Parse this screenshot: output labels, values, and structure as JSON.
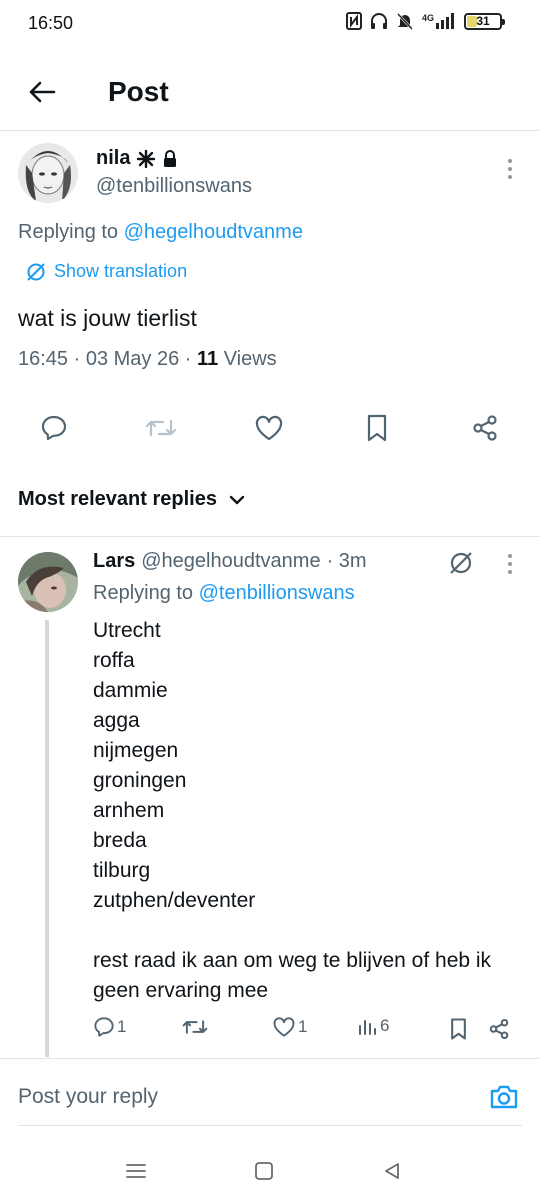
{
  "status_bar": {
    "time": "16:50",
    "network": "4G",
    "battery": "31",
    "battery_level": 0.31,
    "icons": [
      "nfc-icon",
      "headphones-icon",
      "bell-muted-icon",
      "signal-icon",
      "battery-icon"
    ]
  },
  "header": {
    "title": "Post",
    "back_icon": "arrow-left-icon"
  },
  "post": {
    "author_name": "nila",
    "author_handle": "@tenbillionswans",
    "badges": [
      "asterisk-icon",
      "lock-icon"
    ],
    "replying_prefix": "Replying to",
    "replying_to": "@hegelhoudtvanme",
    "show_translation": "Show translation",
    "text": "wat is jouw tierlist",
    "timestamp": "16:45 · 03 May 26 · ",
    "views_count": "11",
    "views_label": " Views",
    "actions": [
      "reply-icon",
      "repost-icon",
      "like-icon",
      "bookmark-icon",
      "share-icon"
    ]
  },
  "replies_sort": {
    "label": "Most relevant replies"
  },
  "reply": {
    "author_name": "Lars",
    "author_handle": "@hegelhoudtvanme",
    "time": "· 3m",
    "replying_prefix": "Replying to",
    "replying_to": "@tenbillionswans",
    "lines": [
      "Utrecht",
      "roffa",
      "dammie",
      "agga",
      "nijmegen",
      "groningen",
      "arnhem",
      "breda",
      "tilburg",
      "zutphen/deventer"
    ],
    "closing": "rest raad ik aan om weg te blijven of heb ik geen ervaring mee",
    "stats": {
      "replies": "1",
      "reposts": "",
      "likes": "1",
      "views": "6"
    }
  },
  "composer": {
    "placeholder": "Post your reply"
  },
  "colors": {
    "accent": "#1d9bf0",
    "secondary_text": "#536471",
    "primary_text": "#0f1419"
  }
}
